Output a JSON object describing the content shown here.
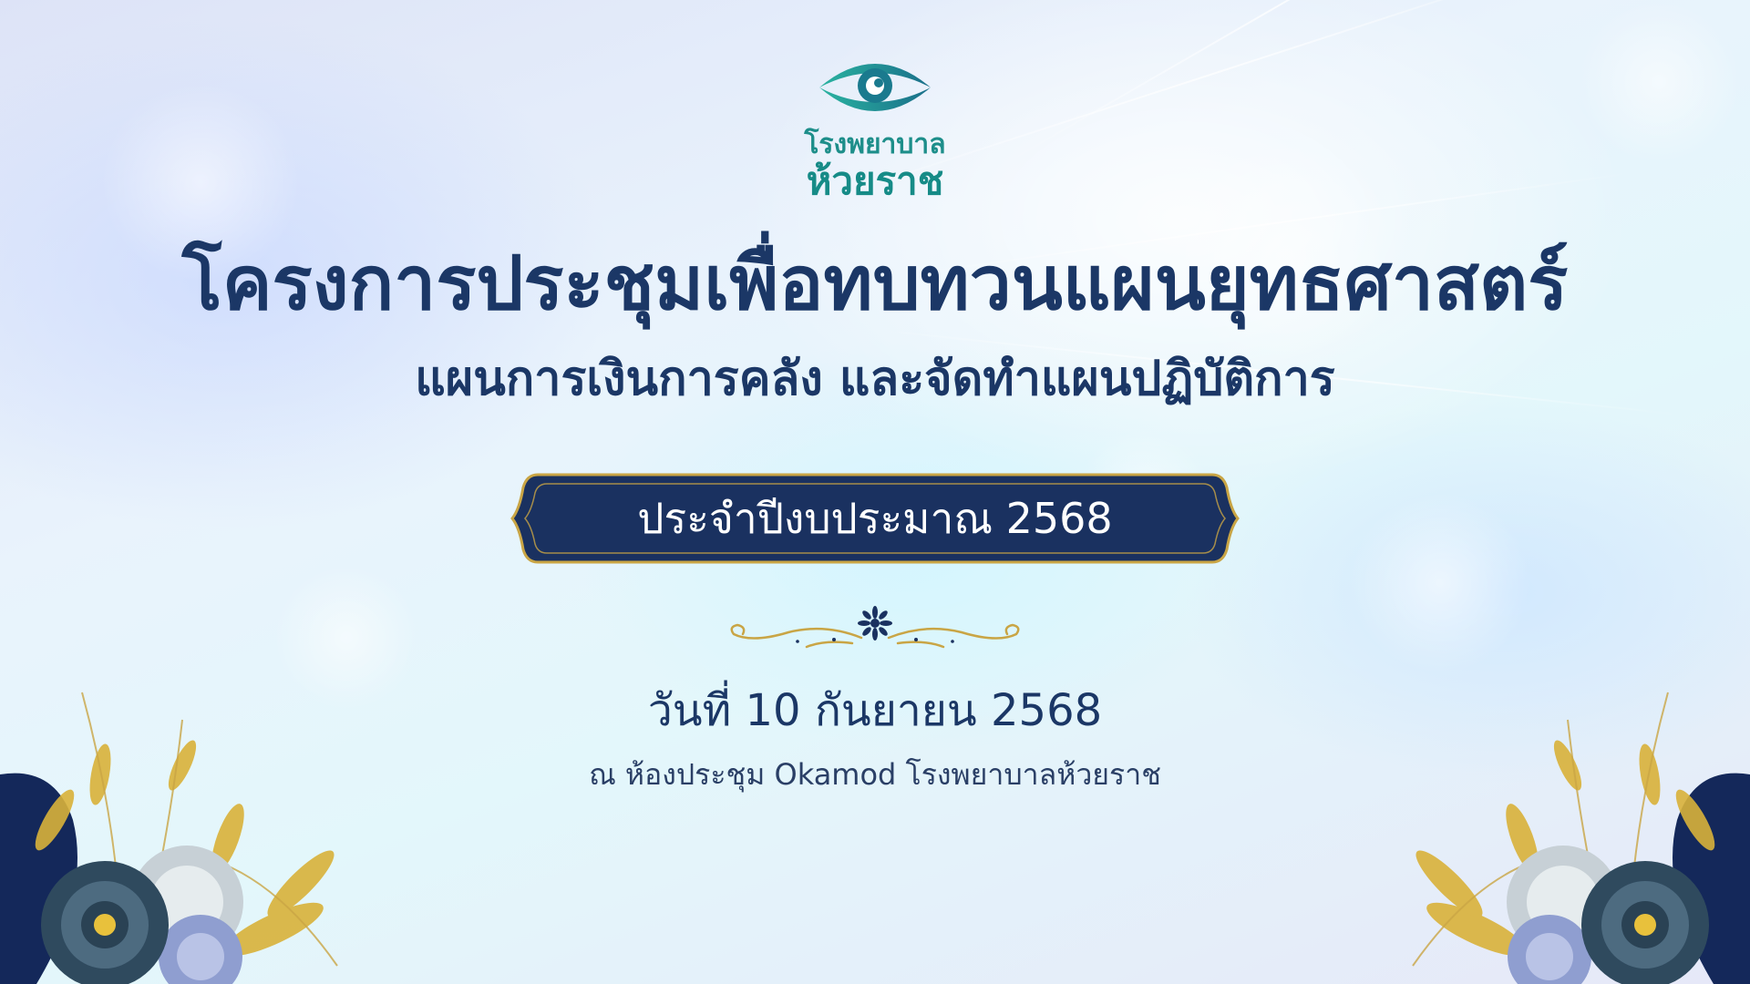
{
  "logo": {
    "icon": "eye-icon",
    "line1": "โรงพยาบาล",
    "line2": "ห้วยราช"
  },
  "title": "โครงการประชุมเพื่อทบทวนแผนยุทธศาสตร์",
  "subtitle": "แผนการเงินการคลัง และจัดทำแผนปฏิบัติการ",
  "banner": {
    "text": "ประจำปีงบประมาณ 2568"
  },
  "date": "วันที่ 10 กันยายน 2568",
  "venue": "ณ ห้องประชุม Okamod โรงพยาบาลห้วยราช",
  "colors": {
    "navy": "#1b3766",
    "banner": "#1a3160",
    "gold": "#c9a545",
    "teal": "#1d8e8a"
  },
  "decor": {
    "ornament": "gold-divider-ornament",
    "corner_left": "floral-corner-left",
    "corner_right": "floral-corner-right"
  }
}
